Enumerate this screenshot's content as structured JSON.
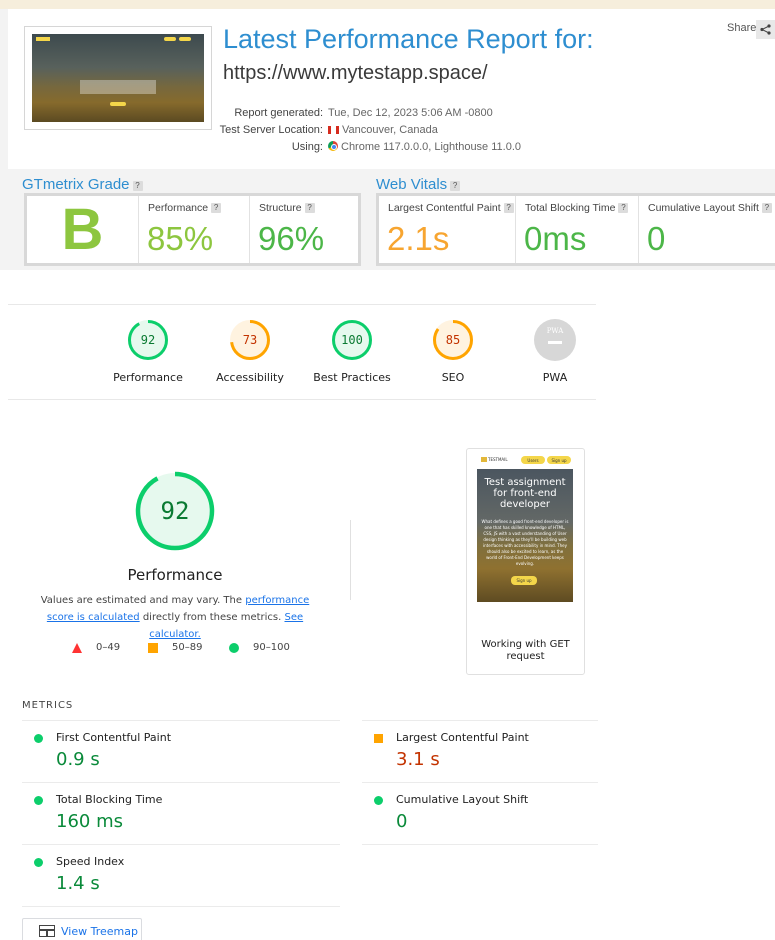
{
  "report": {
    "title": "Latest Performance Report for:",
    "url": "https://www.mytestapp.space/",
    "share_label": "Share",
    "meta": [
      {
        "label": "Report generated:",
        "value": "Tue, Dec 12, 2023 5:06 AM -0800",
        "icon": ""
      },
      {
        "label": "Test Server Location:",
        "value": "Vancouver, Canada",
        "icon": "canada-flag-icon"
      },
      {
        "label": "Using:",
        "value": "Chrome 117.0.0.0, Lighthouse 11.0.0",
        "icon": "chrome-icon"
      }
    ]
  },
  "grade": {
    "title": "GTmetrix Grade",
    "letter": "B",
    "performance_label": "Performance",
    "performance_value": "85%",
    "structure_label": "Structure",
    "structure_value": "96%"
  },
  "web_vitals": {
    "title": "Web Vitals",
    "lcp_label": "Largest Contentful Paint",
    "lcp_value": "2.1s",
    "tbt_label": "Total Blocking Time",
    "tbt_value": "0ms",
    "cls_label": "Cumulative Layout Shift",
    "cls_value": "0"
  },
  "categories": [
    {
      "label": "Performance",
      "score": "92",
      "value": 92,
      "color": "#0cce6b",
      "text_color": "#0a7a32",
      "bg": "#e6f9ee"
    },
    {
      "label": "Accessibility",
      "score": "73",
      "value": 73,
      "color": "#ffa400",
      "text_color": "#c33300",
      "bg": "#fff3e0"
    },
    {
      "label": "Best Practices",
      "score": "100",
      "value": 100,
      "color": "#0cce6b",
      "text_color": "#0a7a32",
      "bg": "#e6f9ee"
    },
    {
      "label": "SEO",
      "score": "85",
      "value": 85,
      "color": "#ffa400",
      "text_color": "#c33300",
      "bg": "#fff3e0"
    },
    {
      "label": "PWA",
      "score": "PWA",
      "value": 0,
      "color": "#d0d0d0",
      "text_color": "#ffffff",
      "bg": "#d0d0d0"
    }
  ],
  "performance": {
    "score": "92",
    "value": 92,
    "title": "Performance",
    "desc_prefix": "Values are estimated and may vary. The ",
    "desc_link1": "performance score is calculated",
    "desc_mid": " directly from these metrics. ",
    "desc_link2": "See calculator.",
    "legend": [
      "0–49",
      "50–89",
      "90–100"
    ]
  },
  "screenshot": {
    "logo_text": "TESTMAIL",
    "nav_btn1": "Users",
    "nav_btn2": "Sign up",
    "heading": "Test assignment for front-end developer",
    "body": "What defines a good front-end developer is one that has skilled knowledge of HTML, CSS, JS with a vast understanding of User design thinking as they'll be building web interfaces with accessibility in mind. They should also be excited to learn, as the world of Front-End Development keeps evolving.",
    "button": "Sign up",
    "caption": "Working with GET request"
  },
  "metrics": {
    "title": "METRICS",
    "items": [
      {
        "name": "First Contentful Paint",
        "value": "0.9 s",
        "status": "good"
      },
      {
        "name": "Largest Contentful Paint",
        "value": "3.1 s",
        "status": "average"
      },
      {
        "name": "Total Blocking Time",
        "value": "160 ms",
        "status": "good"
      },
      {
        "name": "Cumulative Layout Shift",
        "value": "0",
        "status": "good"
      },
      {
        "name": "Speed Index",
        "value": "1.4 s",
        "status": "good"
      }
    ]
  },
  "treemap_label": "View Treemap"
}
